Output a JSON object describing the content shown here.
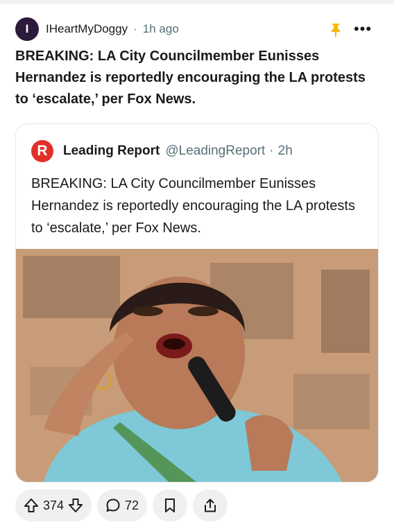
{
  "post": {
    "avatar_letter": "I",
    "author": "IHeartMyDoggy",
    "separator": "·",
    "time": "1h ago",
    "pin_icon": "pin-icon",
    "more_icon": "more-icon",
    "more_label": "•••",
    "title": "BREAKING: LA City Councilmember Eunisses Hernandez is reportedly encouraging the LA protests to ‘escalate,’ per Fox News."
  },
  "embed": {
    "logo_letter": "R",
    "name": "Leading Report",
    "handle": "@LeadingReport",
    "separator": "·",
    "time": "2h",
    "text": "BREAKING: LA City Councilmember Eunisses Hernandez is reportedly encouraging the LA protests to ‘escalate,’ per Fox News.",
    "image_icon": "photo-of-speaker-with-microphone"
  },
  "actions": {
    "upvote_icon": "upvote-icon",
    "vote_count": "374",
    "downvote_icon": "downvote-icon",
    "comment_icon": "comment-icon",
    "comment_count": "72",
    "save_icon": "bookmark-icon",
    "share_icon": "share-icon"
  },
  "colors": {
    "avatar_bg": "#2c1a3a",
    "pin": "#f5b800",
    "logo": "#e0302a",
    "pill_bg": "#eef0f2"
  }
}
